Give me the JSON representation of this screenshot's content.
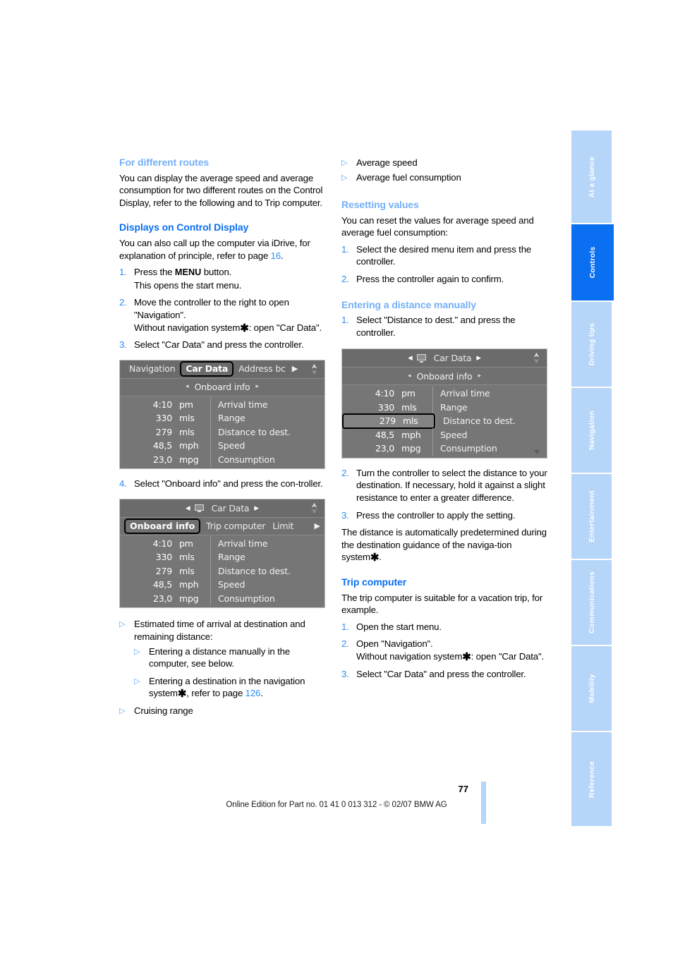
{
  "document": {
    "page_number": "77",
    "footer": "Online Edition for Part no. 01 41 0 013 312 - © 02/07 BMW AG"
  },
  "sidebar": {
    "items": [
      {
        "label": "At a glance",
        "active": false
      },
      {
        "label": "Controls",
        "active": true
      },
      {
        "label": "Driving tips",
        "active": false
      },
      {
        "label": "Navigation",
        "active": false
      },
      {
        "label": "Entertainment",
        "active": false
      },
      {
        "label": "Communications",
        "active": false
      },
      {
        "label": "Mobility",
        "active": false
      },
      {
        "label": "Reference",
        "active": false
      }
    ]
  },
  "left_column": {
    "sub1_title": "For different routes",
    "sub1_body": "You can display the average speed and average consumption for two different routes on the Control Display, refer to the following and to Trip computer.",
    "sec1_title": "Displays on Control Display",
    "sec1_body_a": "You can also call up the computer via iDrive, for explanation of principle, refer to page ",
    "sec1_body_page": "16",
    "sec1_body_b": ".",
    "steps": [
      {
        "num": "1.",
        "line1_pre": "Press the ",
        "line1_key": "MENU",
        "line1_post": " button.",
        "line2": "This opens the start menu."
      },
      {
        "num": "2.",
        "line1": "Move the controller to the right to open \"Navigation\".",
        "line2_pre": "Without navigation system",
        "line2_post": ": open \"Car Data\"."
      },
      {
        "num": "3.",
        "line1": "Select \"Car Data\" and press the controller."
      }
    ],
    "step4": {
      "num": "4.",
      "text": "Select \"Onboard info\" and press the con-troller."
    },
    "bullets": [
      {
        "text": "Estimated time of arrival at destination and remaining distance:",
        "level": 1
      },
      {
        "text": "Entering a distance manually in the computer, see below.",
        "level": 2
      },
      {
        "text_pre": "Entering a destination in the navigation system",
        "text_mid": ", refer to page ",
        "page": "126",
        "text_post": ".",
        "level": 2
      },
      {
        "text": "Cruising range",
        "level": 1
      }
    ]
  },
  "right_column": {
    "top_bullets": [
      "Average speed",
      "Average fuel consumption"
    ],
    "sub2_title": "Resetting values",
    "sub2_body": "You can reset the values for average speed and average fuel consumption:",
    "sub2_steps": [
      {
        "num": "1.",
        "text": "Select the desired menu item and press the controller."
      },
      {
        "num": "2.",
        "text": "Press the controller again to confirm."
      }
    ],
    "sub3_title": "Entering a distance manually",
    "sub3_step1": {
      "num": "1.",
      "text": "Select \"Distance to dest.\" and press the controller."
    },
    "sub3_steps_after": [
      {
        "num": "2.",
        "text": "Turn the controller to select the distance to your destination. If necessary, hold it against a slight resistance to enter a greater difference."
      },
      {
        "num": "3.",
        "text": "Press the controller to apply the setting."
      }
    ],
    "sub3_note_pre": "The distance is automatically predetermined during the destination guidance of the naviga-tion system",
    "sub3_note_post": ".",
    "sec2_title": "Trip computer",
    "sec2_body": "The trip computer is suitable for a vacation trip, for example.",
    "sec2_steps": [
      {
        "num": "1.",
        "line1": "Open the start menu."
      },
      {
        "num": "2.",
        "line1": "Open \"Navigation\".",
        "line2_pre": "Without navigation system",
        "line2_post": ": open \"Car Data\"."
      },
      {
        "num": "3.",
        "line1": "Select \"Car Data\" and press the controller."
      }
    ]
  },
  "idrive_screens": [
    {
      "id": "screen-nav-cardata",
      "topbar": {
        "tabs": [
          "Navigation",
          "Car Data",
          "Address bc"
        ],
        "selected": "Car Data",
        "more_arrow": "▶"
      },
      "subheader": {
        "label": "Onboard info",
        "left_arrow": "◂",
        "right_arrow": "▸"
      },
      "rows": [
        {
          "value": "4:10",
          "unit": "pm",
          "name": "Arrival time",
          "highlighted": false
        },
        {
          "value": "330",
          "unit": "mls",
          "name": "Range",
          "highlighted": false
        },
        {
          "value": "279",
          "unit": "mls",
          "name": "Distance to dest.",
          "highlighted": false
        },
        {
          "value": "48,5",
          "unit": "mph",
          "name": "Speed",
          "highlighted": false
        },
        {
          "value": "23,0",
          "unit": "mpg",
          "name": "Consumption",
          "highlighted": false
        }
      ]
    },
    {
      "id": "screen-cardata-onboard",
      "topbar_center": {
        "label": "Car Data",
        "left_arrow": "◂",
        "right_arrow": "▸",
        "icon": "monitor-icon"
      },
      "submenu": {
        "items": [
          "Onboard info",
          "Trip computer",
          "Limit"
        ],
        "selected": "Onboard info",
        "more_arrow": "▶"
      },
      "rows": [
        {
          "value": "4:10",
          "unit": "pm",
          "name": "Arrival time",
          "highlighted": false
        },
        {
          "value": "330",
          "unit": "mls",
          "name": "Range",
          "highlighted": false
        },
        {
          "value": "279",
          "unit": "mls",
          "name": "Distance to dest.",
          "highlighted": false
        },
        {
          "value": "48,5",
          "unit": "mph",
          "name": "Speed",
          "highlighted": false
        },
        {
          "value": "23,0",
          "unit": "mpg",
          "name": "Consumption",
          "highlighted": false
        }
      ]
    },
    {
      "id": "screen-distance-select",
      "topbar_center": {
        "label": "Car Data",
        "left_arrow": "◂",
        "right_arrow": "▸",
        "icon": "monitor-icon"
      },
      "subheader": {
        "label": "Onboard info",
        "left_arrow": "◂",
        "right_arrow": "▸"
      },
      "rows": [
        {
          "value": "4:10",
          "unit": "pm",
          "name": "Arrival time",
          "highlighted": false
        },
        {
          "value": "330",
          "unit": "mls",
          "name": "Range",
          "highlighted": false
        },
        {
          "value": "279",
          "unit": "mls",
          "name": "Distance to dest.",
          "highlighted": true
        },
        {
          "value": "48,5",
          "unit": "mph",
          "name": "Speed",
          "highlighted": false
        },
        {
          "value": "23,0",
          "unit": "mpg",
          "name": "Consumption",
          "highlighted": false
        }
      ]
    }
  ],
  "colors": {
    "heading_blue": "#0a6ff0",
    "subheading_blue": "#74b0f7",
    "tab_inactive": "#b5d5f9",
    "tab_active": "#0a6ff0",
    "list_number": "#2b8cf5"
  }
}
